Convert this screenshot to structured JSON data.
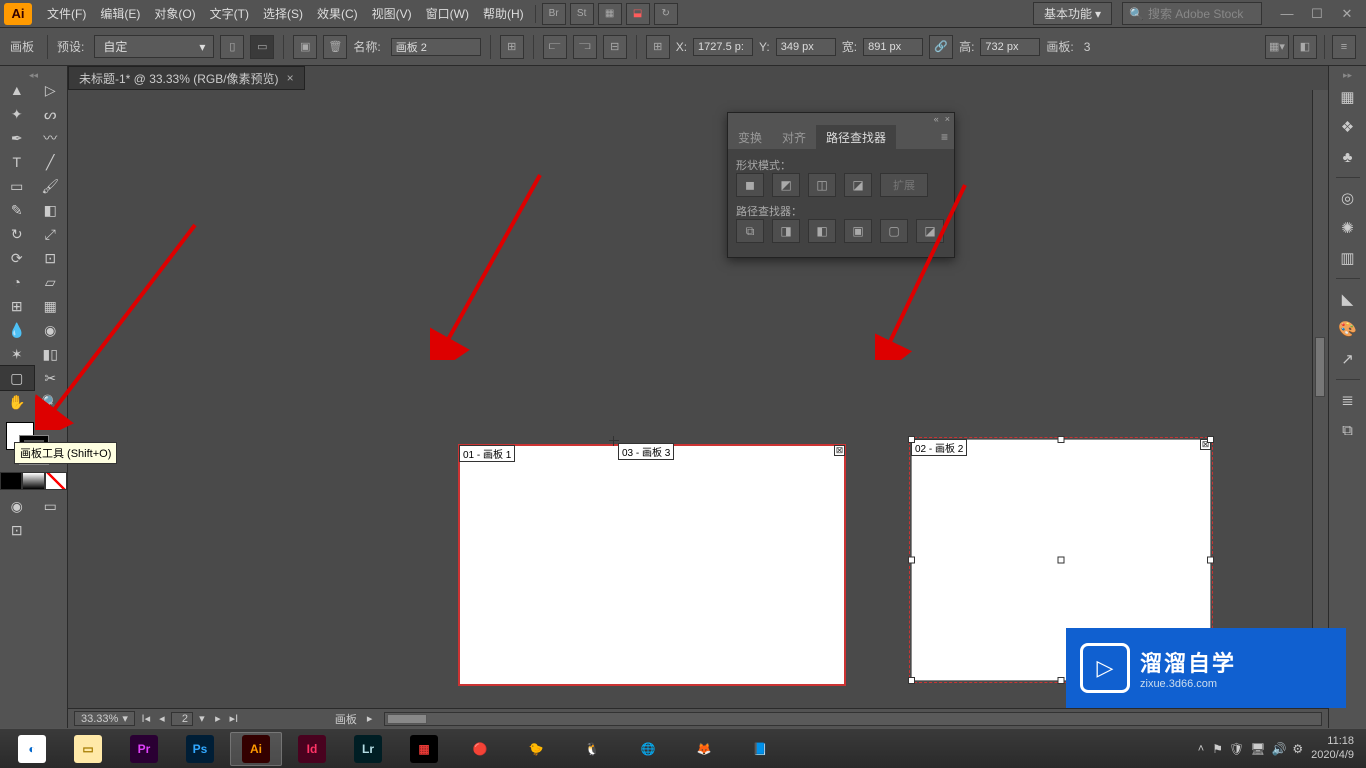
{
  "app": {
    "name": "Ai"
  },
  "menu": [
    "文件(F)",
    "编辑(E)",
    "对象(O)",
    "文字(T)",
    "选择(S)",
    "效果(C)",
    "视图(V)",
    "窗口(W)",
    "帮助(H)"
  ],
  "menu_icons": [
    "Br",
    "St"
  ],
  "workspace": "基本功能",
  "searchPlaceholder": "搜索 Adobe Stock",
  "controlbar": {
    "tool": "画板",
    "presetLabel": "预设:",
    "preset": "自定",
    "nameLabel": "名称:",
    "name": "画板 2",
    "x": "1727.5 p:",
    "xLabel": "X:",
    "y": "349 px",
    "yLabel": "Y:",
    "w": "891 px",
    "wLabel": "宽:",
    "h": "732 px",
    "hLabel": "高:",
    "artboardsLabel": "画板:",
    "artboards": "3"
  },
  "docTab": "未标题-1* @ 33.33% (RGB/像素预览)",
  "tooltip": "画板工具 (Shift+O)",
  "artboards": {
    "ab1": "01 - 画板 1",
    "ab2": "02 - 画板 2",
    "ab3": "03 - 画板 3"
  },
  "panel": {
    "tabs": [
      "变换",
      "对齐",
      "路径查找器"
    ],
    "label1": "形状模式：",
    "label2": "路径查找器：",
    "expand": "扩展"
  },
  "status": {
    "zoom": "33.33%",
    "nav": "2",
    "label": "画板"
  },
  "watermark": {
    "title": "溜溜自学",
    "sub": "zixue.3d66.com"
  },
  "clock": {
    "time": "11:18",
    "date": "2020/4/9"
  },
  "taskbar": [
    {
      "bg": "#fff",
      "fg": "#06c",
      "txt": "◐"
    },
    {
      "bg": "#ffe9a8",
      "fg": "#a67c00",
      "txt": "▭"
    },
    {
      "bg": "#2a0033",
      "fg": "#e040fb",
      "txt": "Pr"
    },
    {
      "bg": "#001e36",
      "fg": "#31a8ff",
      "txt": "Ps"
    },
    {
      "bg": "#330000",
      "fg": "#ff9a00",
      "txt": "Ai"
    },
    {
      "bg": "#49021f",
      "fg": "#ff3366",
      "txt": "Id"
    },
    {
      "bg": "#001e24",
      "fg": "#b4dde4",
      "txt": "Lr"
    },
    {
      "bg": "#000",
      "fg": "#e53935",
      "txt": "▦"
    },
    {
      "bg": "transparent",
      "fg": "",
      "txt": "🔴"
    },
    {
      "bg": "transparent",
      "fg": "",
      "txt": "🐤"
    },
    {
      "bg": "transparent",
      "fg": "",
      "txt": "🐧"
    },
    {
      "bg": "transparent",
      "fg": "",
      "txt": "🌐"
    },
    {
      "bg": "transparent",
      "fg": "",
      "txt": "🦊"
    },
    {
      "bg": "transparent",
      "fg": "",
      "txt": "📘"
    }
  ]
}
